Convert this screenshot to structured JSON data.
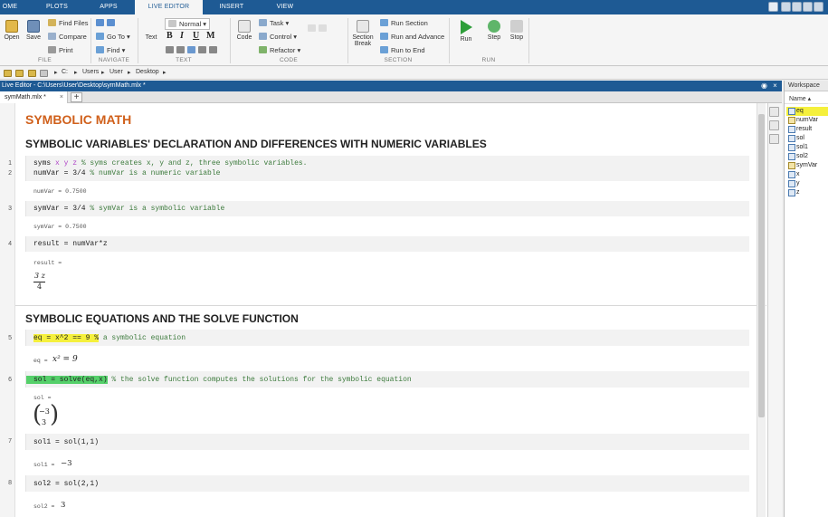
{
  "tabs": [
    "OME",
    "PLOTS",
    "APPS",
    "LIVE EDITOR",
    "INSERT",
    "VIEW"
  ],
  "ribbon": {
    "file": {
      "open": "Open",
      "save": "Save",
      "find_files": "Find Files",
      "compare": "Compare",
      "print": "Print",
      "label": "FILE"
    },
    "navigate": {
      "go_to": "Go To",
      "find": "Find",
      "label": "NAVIGATE"
    },
    "text": {
      "style": "Normal",
      "text_btn": "Text",
      "bold": "B",
      "italic": "I",
      "underline": "U",
      "mono": "M",
      "label": "TEXT"
    },
    "code": {
      "code_btn": "Code",
      "task": "Task",
      "control": "Control",
      "refactor": "Refactor",
      "label": "CODE"
    },
    "section": {
      "section_break_1": "Section",
      "section_break_2": "Break",
      "run_section": "Run Section",
      "run_and_advance": "Run and Advance",
      "run_to_end": "Run to End",
      "label": "SECTION"
    },
    "run": {
      "run": "Run",
      "step": "Step",
      "stop": "Stop",
      "label": "RUN"
    }
  },
  "address": {
    "drive": "C:",
    "p1": "Users",
    "p2": "User",
    "p3": "Desktop"
  },
  "editor": {
    "title": "Live Editor - C:\\Users\\User\\Desktop\\symMath.mlx *",
    "file_tab": "symMath.mlx *",
    "close": "×",
    "plus": "+"
  },
  "doc": {
    "title": "SYMBOLIC MATH",
    "h_decl": "SYMBOLIC VARIABLES' DECLARATION AND DIFFERENCES WITH NUMERIC VARIABLES",
    "line1_kw": "syms ",
    "line1_vars": "x y z",
    "line1_cm": " % syms creates x, y and z, three symbolic variables.",
    "line2_code": "numVar = 3/4 ",
    "line2_cm": "% numVar is a numeric variable",
    "out_numvar": "numVar = 0.7500",
    "line3_code": "symVar = 3/4 ",
    "line3_cm": "% symVar is a symbolic variable",
    "out_symvar": "symVar = 0.7500",
    "line4_code": "result = numVar*z",
    "out_result": "result =",
    "frac_num": "3 z",
    "frac_den": "4",
    "h_solve": "SYMBOLIC EQUATIONS AND THE SOLVE FUNCTION",
    "line5_code": "eq = x^2 == 9 %",
    "line5_cm": " a symbolic equation",
    "out_eq_label": "eq =",
    "out_eq_val": "x² = 9",
    "line6_code": "sol = solve(eq,x)",
    "line6_cm": " % the solve function computes the solutions for the symbolic equation",
    "out_sol": "sol =",
    "sol_v1": "−3",
    "sol_v2": "3",
    "line7_code": "sol1 = sol(1,1)",
    "out_sol1_label": "sol1 =",
    "out_sol1_val": "−3",
    "line8_code": "sol2 = sol(2,1)",
    "out_sol2_label": "sol2 =",
    "out_sol2_val": "3"
  },
  "line_numbers": [
    "1",
    "2",
    "3",
    "4",
    "5",
    "6",
    "7",
    "8"
  ],
  "workspace": {
    "title": "Workspace",
    "header": "Name ▴",
    "items": [
      "eq",
      "numVar",
      "result",
      "sol",
      "sol1",
      "sol2",
      "symVar",
      "x",
      "y",
      "z"
    ]
  }
}
